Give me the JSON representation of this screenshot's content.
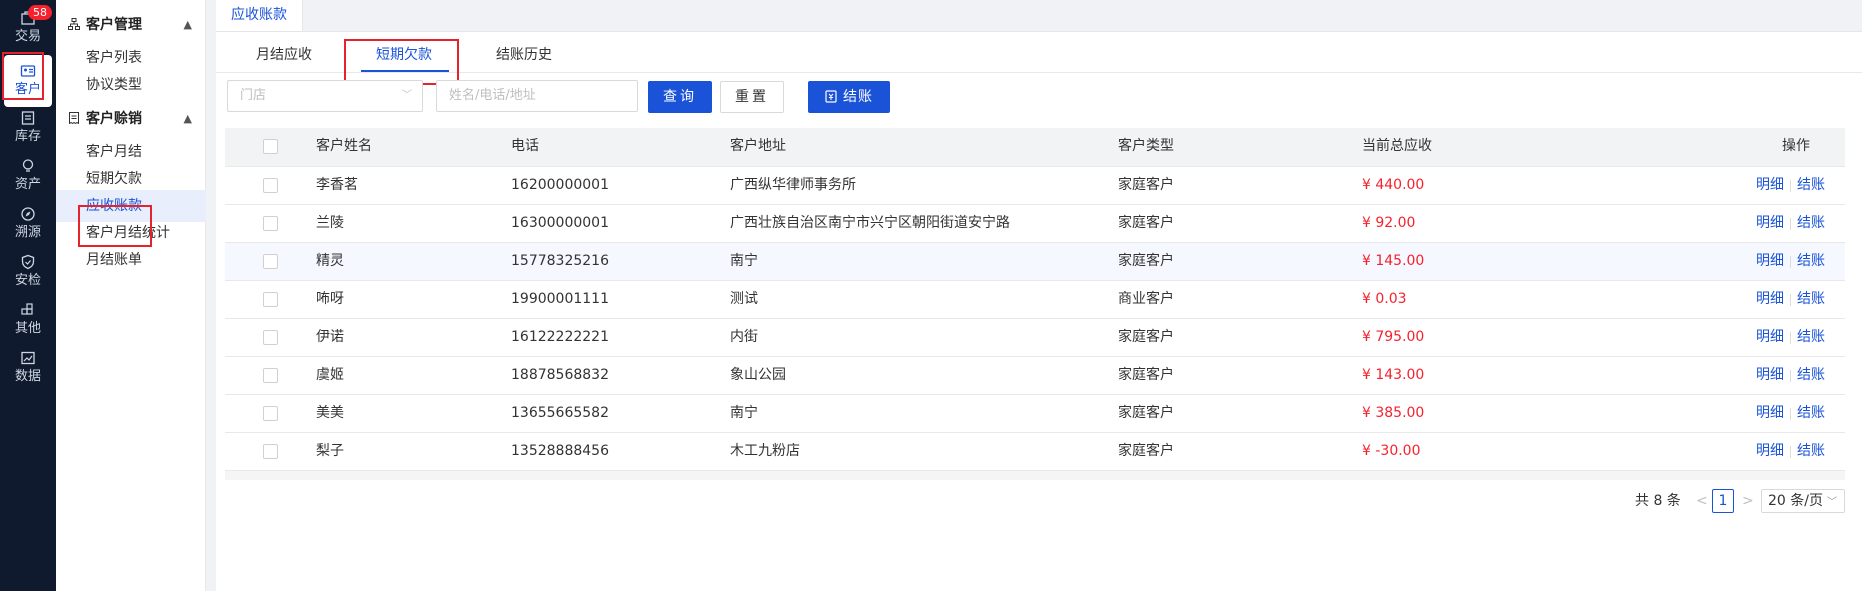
{
  "rail": {
    "badge": "58",
    "items": [
      {
        "label": "交易",
        "icon": "transaction-icon"
      },
      {
        "label": "客户",
        "icon": "customer-card-icon"
      },
      {
        "label": "库存",
        "icon": "inventory-icon"
      },
      {
        "label": "资产",
        "icon": "asset-bulb-icon"
      },
      {
        "label": "溯源",
        "icon": "trace-compass-icon"
      },
      {
        "label": "安检",
        "icon": "security-shield-icon"
      },
      {
        "label": "其他",
        "icon": "other-grid-icon"
      },
      {
        "label": "数据",
        "icon": "data-chart-icon"
      }
    ]
  },
  "sidebar": {
    "group1": {
      "title": "客户管理",
      "items": [
        "客户列表",
        "协议类型"
      ]
    },
    "group2": {
      "title": "客户赊销",
      "items": [
        "客户月结",
        "短期欠款",
        "应收账款",
        "客户月结统计",
        "月结账单"
      ]
    }
  },
  "page_tab": "应收账款",
  "tabs": [
    "月结应收",
    "短期欠款",
    "结账历史"
  ],
  "filters": {
    "store_placeholder": "门店",
    "search_placeholder": "姓名/电话/地址",
    "query_button": "查询",
    "reset_button": "重置",
    "settle_button": "结账"
  },
  "table": {
    "columns": [
      "客户姓名",
      "电话",
      "客户地址",
      "客户类型",
      "当前总应收",
      "操作"
    ],
    "rows": [
      {
        "name": "李香茗",
        "phone": "16200000001",
        "address": "广西纵华律师事务所",
        "type": "家庭客户",
        "amount": "¥ 440.00"
      },
      {
        "name": "兰陵",
        "phone": "16300000001",
        "address": "广西壮族自治区南宁市兴宁区朝阳街道安宁路",
        "type": "家庭客户",
        "amount": "¥ 92.00"
      },
      {
        "name": "精灵",
        "phone": "15778325216",
        "address": "南宁",
        "type": "家庭客户",
        "amount": "¥ 145.00"
      },
      {
        "name": "咘呀",
        "phone": "19900001111",
        "address": "测试",
        "type": "商业客户",
        "amount": "¥ 0.03"
      },
      {
        "name": "伊诺",
        "phone": "16122222221",
        "address": "内街",
        "type": "家庭客户",
        "amount": "¥ 795.00"
      },
      {
        "name": "虞姬",
        "phone": "18878568832",
        "address": "象山公园",
        "type": "家庭客户",
        "amount": "¥ 143.00"
      },
      {
        "name": "美美",
        "phone": "13655665582",
        "address": "南宁",
        "type": "家庭客户",
        "amount": "¥ 385.00"
      },
      {
        "name": "梨子",
        "phone": "13528888456",
        "address": "木工九粉店",
        "type": "家庭客户",
        "amount": "¥ -30.00"
      }
    ],
    "op_detail": "明细",
    "op_settle": "结账"
  },
  "pagination": {
    "total": "共 8 条",
    "current": "1",
    "page_size": "20 条/页",
    "prev": "<",
    "next": ">"
  }
}
